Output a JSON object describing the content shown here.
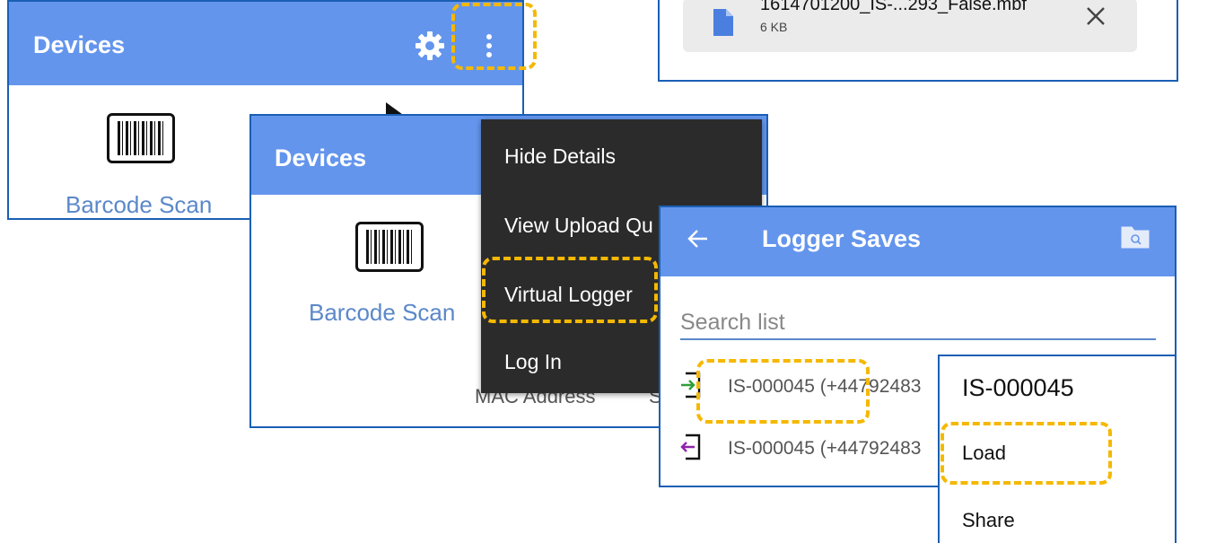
{
  "panel1": {
    "title": "Devices",
    "settings_icon": "gear-icon",
    "overflow_icon": "more-vert-icon",
    "barcode_label": "Barcode Scan"
  },
  "download": {
    "file_name": "1614701200_IS-...293_False.mbf",
    "file_size": "6 KB",
    "close_icon": "close-icon",
    "file_icon": "file-icon"
  },
  "panel2": {
    "title": "Devices",
    "barcode_label": "Barcode Scan",
    "mac_label": "MAC Address",
    "trailing_char": "S"
  },
  "overflow_menu": {
    "items": [
      "Hide Details",
      "View Upload Qu",
      "Virtual Logger",
      "Log In"
    ]
  },
  "logger": {
    "title": "Logger Saves",
    "back_icon": "back-arrow-icon",
    "folder_icon": "folder-search-icon",
    "search_placeholder": "Search list",
    "rows": [
      {
        "label": "IS-000045 (+44792483",
        "icon": "import-icon",
        "icon_color": "#2e9e3a"
      },
      {
        "label": "IS-000045 (+44792483",
        "icon": "export-icon",
        "icon_color": "#8e24aa"
      }
    ]
  },
  "context_menu": {
    "title": "IS-000045",
    "items": [
      "Load",
      "Share"
    ]
  },
  "colors": {
    "appbar": "#6495ed",
    "border": "#1a5fb4",
    "highlight": "#f5b800",
    "menu_bg": "#2b2b2b",
    "link_text": "#5b88c9"
  }
}
